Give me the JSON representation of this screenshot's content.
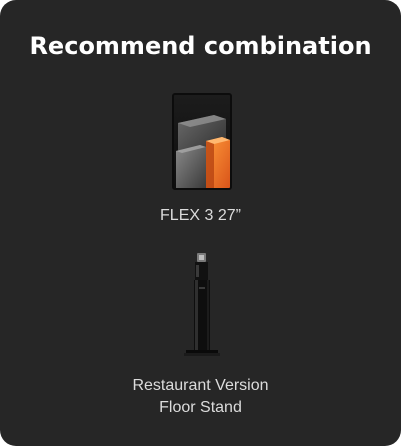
{
  "card": {
    "title": "Recommend combination",
    "background": "#262626"
  },
  "products": [
    {
      "name": "FLEX 3 27”",
      "image_icon": "monitor-icon"
    },
    {
      "name_line1": "Restaurant Version",
      "name_line2": "Floor Stand",
      "image_icon": "floor-stand-icon"
    }
  ],
  "colors": {
    "accent_orange": "#f07a2a",
    "text": "#ffffff"
  }
}
